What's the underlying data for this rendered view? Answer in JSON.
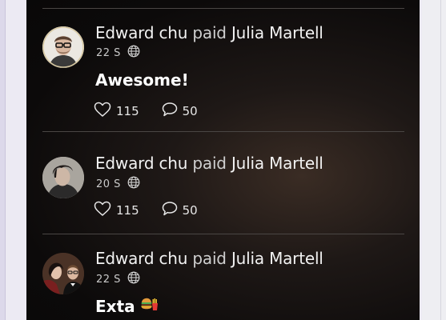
{
  "feed": {
    "items": [
      {
        "actor": "Edward chu",
        "verb": "paid",
        "target": "Julia Martell",
        "time": "22 S",
        "message": "Awesome!",
        "likes": "115",
        "comments": "50"
      },
      {
        "actor": "Edward chu",
        "verb": "paid",
        "target": "Julia Martell",
        "time": "20 S",
        "message": "",
        "likes": "115",
        "comments": "50"
      },
      {
        "actor": "Edward chu",
        "verb": "paid",
        "target": "Julia Martell",
        "time": "22 S",
        "message": "Exta",
        "likes": "",
        "comments": ""
      }
    ]
  }
}
